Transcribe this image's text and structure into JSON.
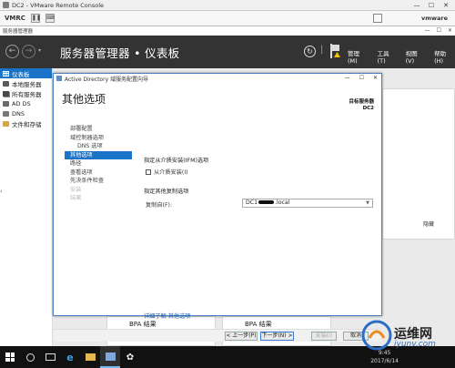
{
  "vm": {
    "title": "DC2 - VMware Remote Console",
    "toolbar_label": "VMRC",
    "brand": "vmware"
  },
  "sm": {
    "window_title": "服务器管理器",
    "header_title": "服务器管理器 • 仪表板",
    "menus": [
      "管理(M)",
      "工具(T)",
      "视图(V)",
      "帮助(H)"
    ]
  },
  "sidebar": {
    "items": [
      {
        "label": "仪表板",
        "icon": "dashboard-icon"
      },
      {
        "label": "本地服务器",
        "icon": "server-icon"
      },
      {
        "label": "所有服务器",
        "icon": "servers-icon"
      },
      {
        "label": "AD DS",
        "icon": "ad-icon"
      },
      {
        "label": "DNS",
        "icon": "dns-icon"
      },
      {
        "label": "文件和存储",
        "icon": "folder-icon"
      }
    ]
  },
  "background": {
    "hide_label": "隐藏",
    "bpa_label": "BPA 结果"
  },
  "wizard": {
    "window_title": "Active Directory 域服务配置向导",
    "heading": "其他选项",
    "target_title": "目标服务器",
    "target_server": "DC2",
    "nav": [
      {
        "label": "部署配置",
        "state": "normal"
      },
      {
        "label": "域控制器选项",
        "state": "normal"
      },
      {
        "label": "DNS 选项",
        "state": "indent"
      },
      {
        "label": "其他选项",
        "state": "active"
      },
      {
        "label": "路径",
        "state": "normal"
      },
      {
        "label": "查看选项",
        "state": "normal"
      },
      {
        "label": "先决条件检查",
        "state": "normal"
      },
      {
        "label": "安装",
        "state": "disabled"
      },
      {
        "label": "结果",
        "state": "disabled"
      }
    ],
    "ifm_section": "指定从介质安装(IFM)选项",
    "ifm_checkbox": "从介质安装(I)",
    "repl_section": "指定其他复制选项",
    "repl_label": "复制自(F):",
    "repl_value_prefix": "DC1",
    "repl_value_suffix": ".local",
    "learn_more": "详细了解 其他选项",
    "buttons": {
      "prev": "< 上一步(P)",
      "next": "下一步(N) >",
      "install": "安装(I)",
      "cancel": "取消"
    }
  },
  "taskbar": {
    "time": "9:45",
    "date": "2017/6/14"
  },
  "watermark": {
    "cn": "运维网",
    "en": "iyunv.com"
  }
}
